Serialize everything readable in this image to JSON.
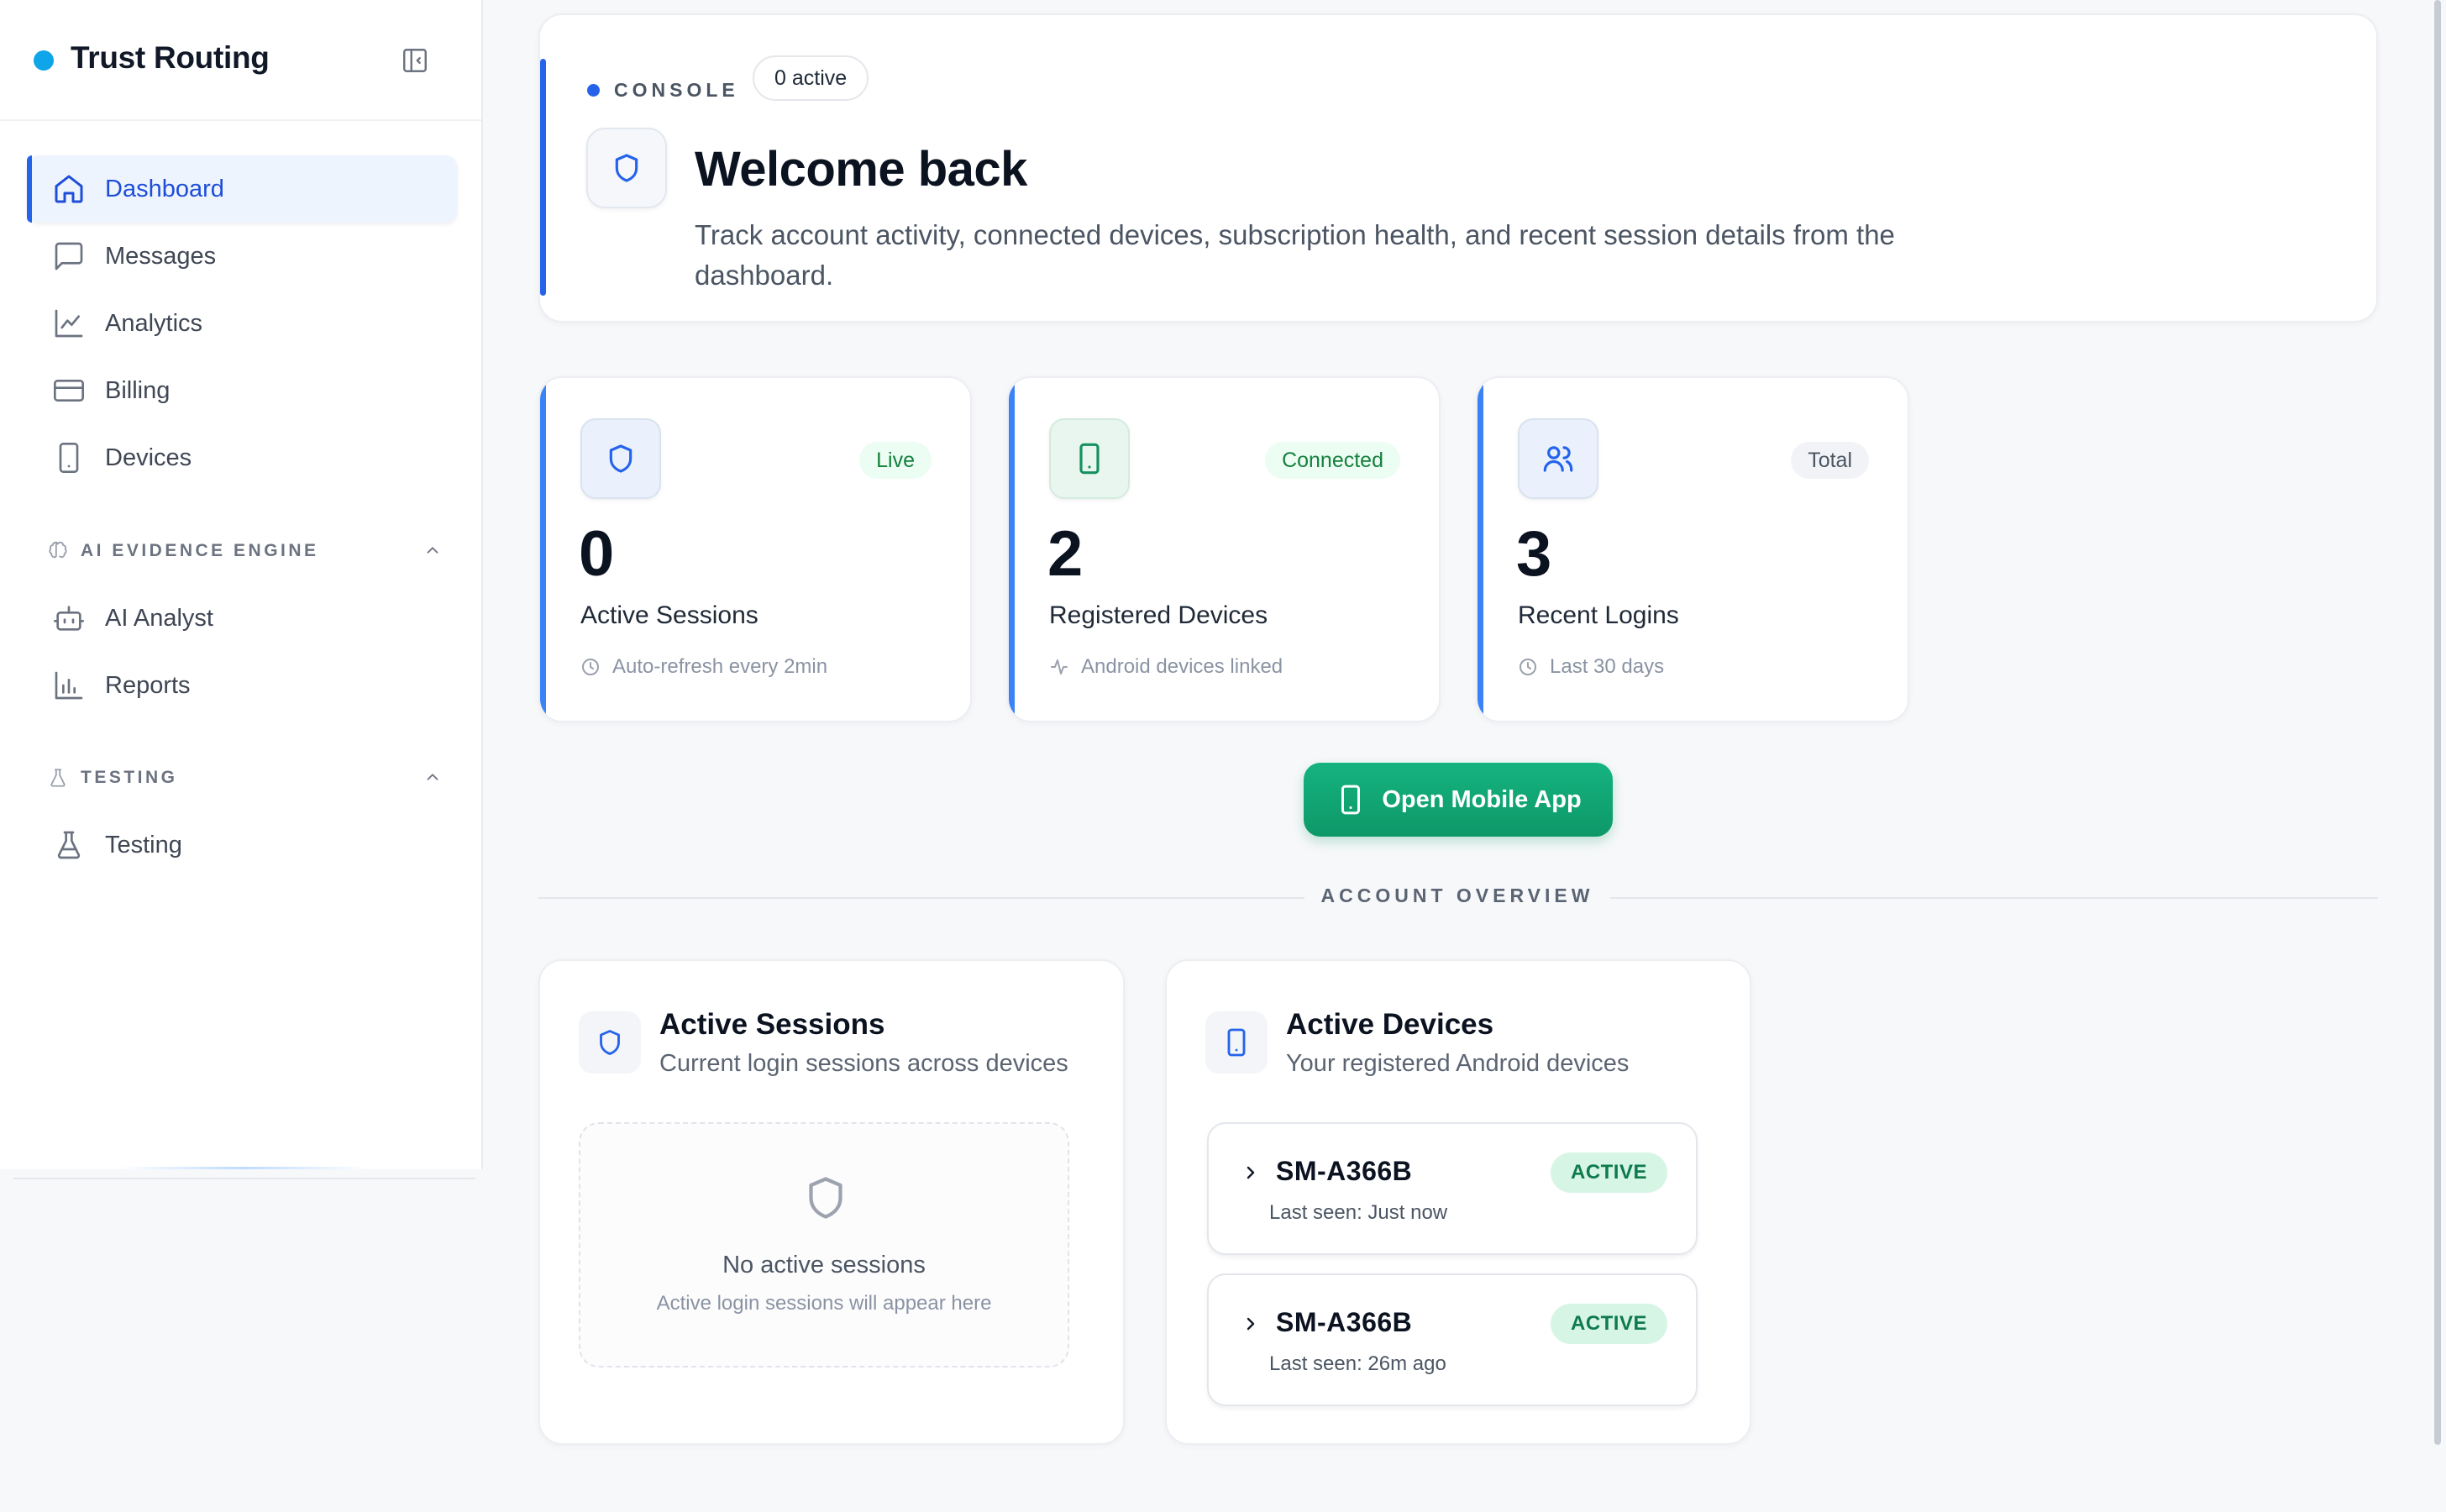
{
  "brand": {
    "name": "Trust Routing",
    "dot_color": "#0ea5e9"
  },
  "sidebar": {
    "items": [
      {
        "label": "Dashboard",
        "icon": "home-icon",
        "active": true
      },
      {
        "label": "Messages",
        "icon": "message-icon"
      },
      {
        "label": "Analytics",
        "icon": "chart-line-icon"
      },
      {
        "label": "Billing",
        "icon": "credit-card-icon"
      },
      {
        "label": "Devices",
        "icon": "phone-icon"
      }
    ],
    "sections": [
      {
        "label": "AI EVIDENCE ENGINE",
        "icon": "brain-icon",
        "items": [
          {
            "label": "AI Analyst",
            "icon": "bot-icon"
          },
          {
            "label": "Reports",
            "icon": "bar-chart-icon"
          }
        ]
      },
      {
        "label": "TESTING",
        "icon": "flask-icon",
        "items": [
          {
            "label": "Testing",
            "icon": "flask-icon"
          }
        ]
      }
    ]
  },
  "header": {
    "console_label": "CONSOLE",
    "active_pill": "0 active",
    "title": "Welcome back",
    "description": "Track account activity, connected devices, subscription health, and recent session details from the dashboard."
  },
  "stats": [
    {
      "value": "0",
      "label": "Active Sessions",
      "badge": "Live",
      "sub": "Auto-refresh every 2min",
      "icon": "shield-icon",
      "sub_icon": "clock-icon"
    },
    {
      "value": "2",
      "label": "Registered Devices",
      "badge": "Connected",
      "sub": "Android devices linked",
      "icon": "phone-icon",
      "sub_icon": "activity-icon"
    },
    {
      "value": "3",
      "label": "Recent Logins",
      "badge": "Total",
      "sub": "Last 30 days",
      "icon": "users-icon",
      "sub_icon": "clock-icon"
    }
  ],
  "actions": {
    "open_app": "Open Mobile App"
  },
  "account_overview": {
    "label": "ACCOUNT OVERVIEW",
    "sessions": {
      "title": "Active Sessions",
      "subtitle": "Current login sessions across devices",
      "empty_title": "No active sessions",
      "empty_sub": "Active login sessions will appear here"
    },
    "devices": {
      "title": "Active Devices",
      "subtitle": "Your registered Android devices",
      "list": [
        {
          "name": "SM-A366B",
          "status": "ACTIVE",
          "last_seen": "Last seen: Just now"
        },
        {
          "name": "SM-A366B",
          "status": "ACTIVE",
          "last_seen": "Last seen: 26m ago"
        }
      ]
    }
  },
  "colors": {
    "accent": "#2563eb",
    "success": "#10a06f",
    "active_badge_bg": "#d7f5e5"
  }
}
